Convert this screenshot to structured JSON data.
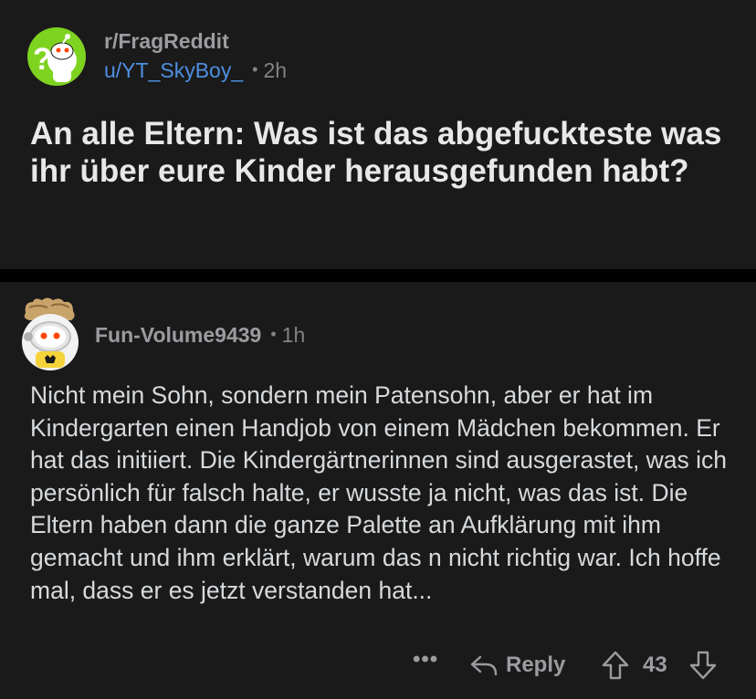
{
  "post": {
    "subreddit": "r/FragReddit",
    "author": "u/YT_SkyBoy_",
    "separator": "•",
    "age": "2h",
    "title": "An alle Eltern: Was ist das abgefuckteste was ihr über eure Kinder herausgefunden habt?"
  },
  "comment": {
    "author": "Fun-Volume9439",
    "separator": "•",
    "age": "1h",
    "body": "Nicht mein Sohn, sondern mein Patensohn, aber er hat im Kindergarten einen Handjob von einem Mädchen bekommen. Er hat das initiiert. Die Kindergärtnerinnen sind ausgerastet, was ich persönlich für falsch halte, er wusste ja nicht, was das ist. Die Eltern haben dann die ganze Palette an Aufklärung mit ihm gemacht und ihm erklärt, warum das n nicht richtig war. Ich hoffe mal, dass er es jetzt verstanden hat...",
    "actions": {
      "more": "•••",
      "reply_label": "Reply",
      "vote_count": "43"
    }
  },
  "icons": {
    "subreddit_avatar": "snoo-question-mark-avatar",
    "comment_avatar": "snoo-astronaut-avatar",
    "reply": "reply-arrow-icon",
    "upvote": "upvote-arrow-icon",
    "downvote": "downvote-arrow-icon"
  },
  "colors": {
    "background": "#1a1a1b",
    "separator": "#000000",
    "username": "#4f8fe0",
    "muted": "#9a9c9f",
    "text": "#d7dadc",
    "avatar_green": "#7ed321"
  }
}
